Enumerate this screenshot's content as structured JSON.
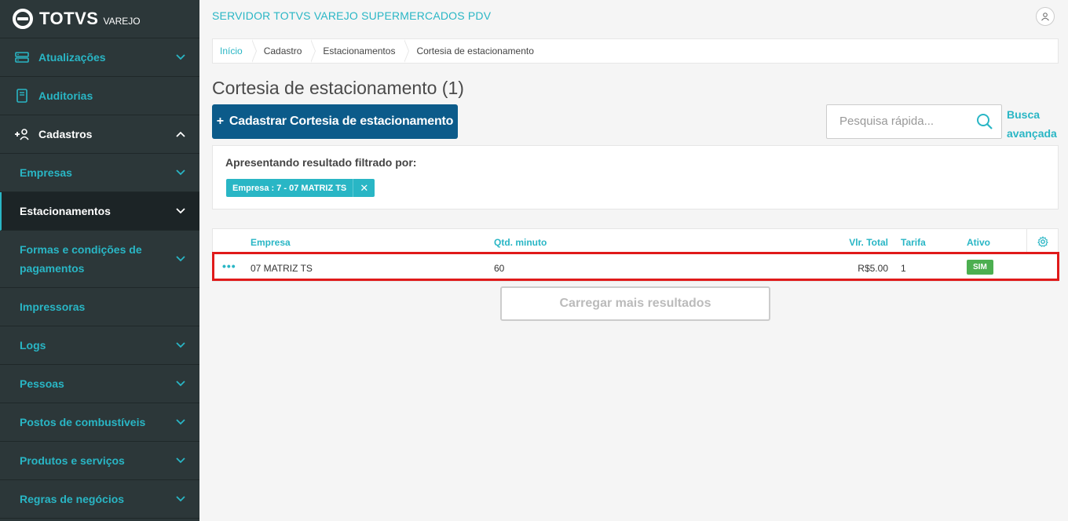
{
  "brand": {
    "name": "TOTVS",
    "sub": "VAREJO"
  },
  "sidebar": {
    "items": [
      {
        "label": "Atualizações",
        "icon": "server-icon"
      },
      {
        "label": "Auditorias",
        "icon": "book-icon"
      },
      {
        "label": "Cadastros",
        "icon": "add-user-icon"
      },
      {
        "label": "Empresas"
      },
      {
        "label": "Estacionamentos"
      },
      {
        "label": "Formas e condições de pagamentos"
      },
      {
        "label": "Impressoras"
      },
      {
        "label": "Logs"
      },
      {
        "label": "Pessoas"
      },
      {
        "label": "Postos de combustíveis"
      },
      {
        "label": "Produtos e serviços"
      },
      {
        "label": "Regras de negócios"
      }
    ]
  },
  "header": {
    "server_title": "SERVIDOR TOTVS VAREJO SUPERMERCADOS PDV"
  },
  "breadcrumb": [
    "Início",
    "Cadastro",
    "Estacionamentos",
    "Cortesia de estacionamento"
  ],
  "page": {
    "title": "Cortesia de estacionamento (1)",
    "add_button": "Cadastrar Cortesia de estacionamento",
    "search_placeholder": "Pesquisa rápida...",
    "advanced_search_line1": "Busca",
    "advanced_search_line2": "avançada"
  },
  "filter": {
    "title": "Apresentando resultado filtrado por:",
    "tag": "Empresa : 7 - 07 MATRIZ TS"
  },
  "table": {
    "columns": [
      "Empresa",
      "Qtd. minuto",
      "Vlr. Total",
      "Tarifa",
      "Ativo"
    ],
    "rows": [
      {
        "empresa": "07 MATRIZ TS",
        "qtd_minuto": "60",
        "vlr_total": "R$5.00",
        "tarifa": "1",
        "ativo": "SIM"
      }
    ]
  },
  "load_more": "Carregar mais resultados",
  "colors": {
    "sidebar_bg": "#2c3739",
    "accent": "#29b6c5",
    "primary": "#0c5b8a",
    "success": "#4caf50",
    "highlight": "#e01a1a"
  }
}
